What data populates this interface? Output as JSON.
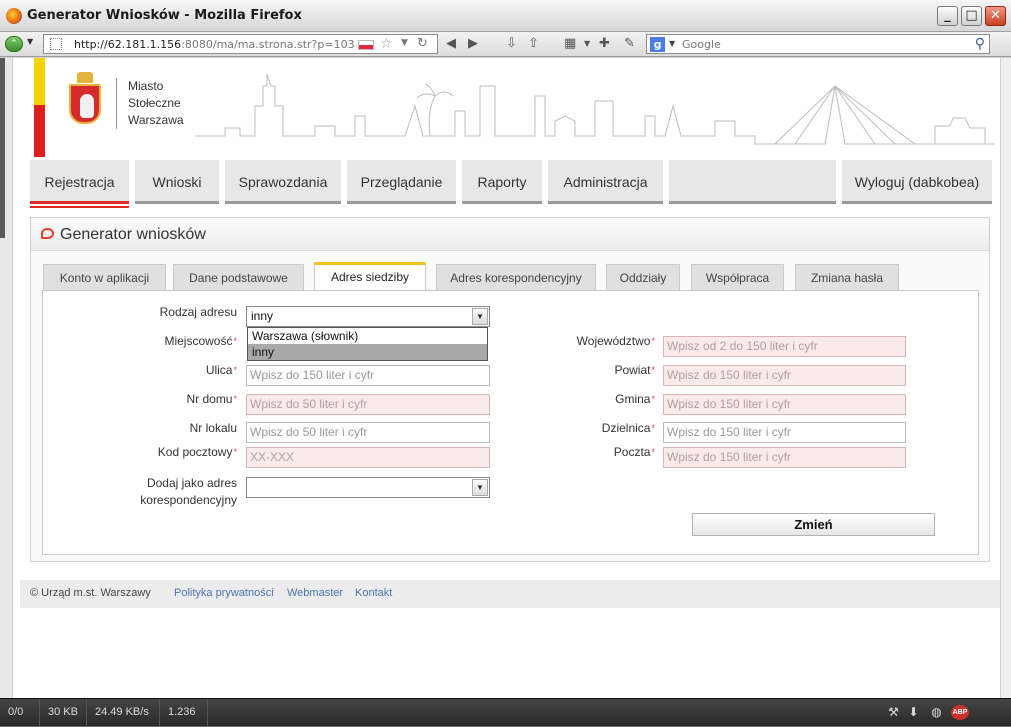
{
  "window": {
    "title": "Generator Wniosków - Mozilla Firefox",
    "buttons": {
      "minimize": "_",
      "maximize": "□",
      "close": "✕"
    }
  },
  "navbar": {
    "url_host": "http://62.181.1.156",
    "url_rest": ":8080/ma/ma.strona.str?p=103",
    "search_engine": "Google"
  },
  "site": {
    "city_name": [
      "Miasto",
      "Stołeczne",
      "Warszawa"
    ]
  },
  "menu": {
    "items": [
      {
        "label": "Rejestracja",
        "active": true
      },
      {
        "label": "Wnioski"
      },
      {
        "label": "Sprawozdania"
      },
      {
        "label": "Przeglądanie"
      },
      {
        "label": "Raporty"
      },
      {
        "label": "Administracja"
      },
      {
        "label": ""
      },
      {
        "label": "Wyloguj (dabkobea)"
      }
    ]
  },
  "panel": {
    "title": "Generator wniosków",
    "tabs": [
      {
        "label": "Konto w aplikacji"
      },
      {
        "label": "Dane podstawowe"
      },
      {
        "label": "Adres siedziby",
        "active": true
      },
      {
        "label": "Adres korespondencyjny"
      },
      {
        "label": "Oddziały"
      },
      {
        "label": "Współpraca"
      },
      {
        "label": "Zmiana hasła"
      }
    ]
  },
  "form": {
    "rodzaj_adresu": {
      "label": "Rodzaj adresu",
      "value": "inny",
      "options": [
        "Warszawa (słownik)",
        "inny"
      ],
      "highlighted": "inny"
    },
    "miejscowosc": {
      "label": "Miejscowość"
    },
    "ulica": {
      "label": "Ulica",
      "placeholder": "Wpisz do 150 liter i cyfr"
    },
    "nr_domu": {
      "label": "Nr domu",
      "placeholder": "Wpisz do 50 liter i cyfr"
    },
    "nr_lokalu": {
      "label": "Nr lokalu",
      "placeholder": "Wpisz do 50 liter i cyfr"
    },
    "kod_pocztowy": {
      "label": "Kod pocztowy",
      "placeholder": "XX-XXX"
    },
    "dodaj_jako": {
      "label_line1": "Dodaj jako adres",
      "label_line2": "korespondencyjny",
      "value": ""
    },
    "wojewodztwo": {
      "label": "Województwo",
      "placeholder": "Wpisz od 2 do 150 liter i cyfr"
    },
    "powiat": {
      "label": "Powiat",
      "placeholder": "Wpisz do 150 liter i cyfr"
    },
    "gmina": {
      "label": "Gmina",
      "placeholder": "Wpisz do 150 liter i cyfr"
    },
    "dzielnica": {
      "label": "Dzielnica",
      "placeholder": "Wpisz do 150 liter i cyfr"
    },
    "poczta": {
      "label": "Poczta",
      "placeholder": "Wpisz do 150 liter i cyfr"
    },
    "required_mark": "*",
    "submit_label": "Zmień"
  },
  "footer": {
    "copyright": "© Urząd m.st. Warszawy",
    "links": [
      "Polityka prywatności",
      "Webmaster",
      "Kontakt"
    ]
  },
  "statusbar": {
    "cells": [
      "0/0",
      "30 KB",
      "24.49 KB/s",
      "1.236"
    ],
    "adblock": "ABP"
  },
  "colors": {
    "brand_yellow": "#f4d400",
    "brand_red": "#dc1e1e",
    "active_tab": "#f0c419",
    "error_field_bg": "#fbeaea",
    "link": "#4a74b8"
  }
}
